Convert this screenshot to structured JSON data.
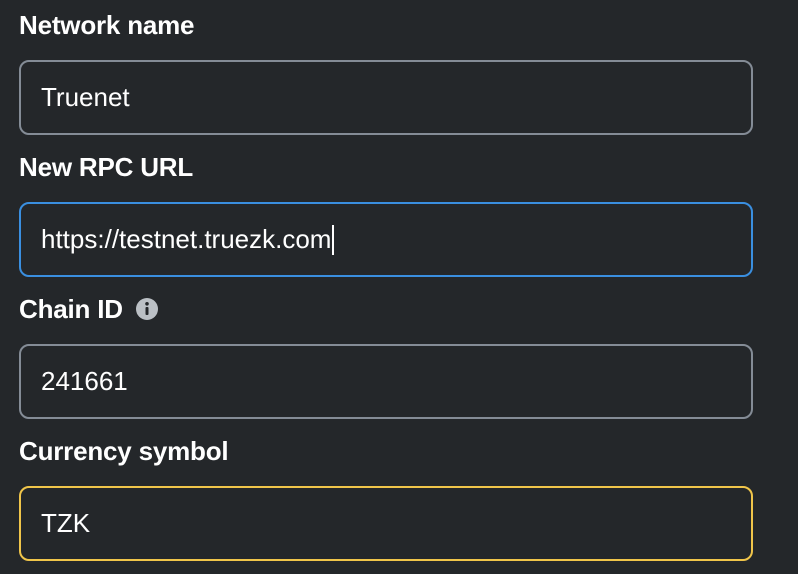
{
  "form": {
    "network_name": {
      "label": "Network name",
      "value": "Truenet"
    },
    "rpc_url": {
      "label": "New RPC URL",
      "value": "https://testnet.truezk.com"
    },
    "chain_id": {
      "label": "Chain ID",
      "info_icon": "info-icon",
      "value": "241661"
    },
    "currency_symbol": {
      "label": "Currency symbol",
      "value": "TZK"
    }
  },
  "colors": {
    "background": "#24272a",
    "default_border": "#848c96",
    "focus_border": "#3a8fe0",
    "warning_border": "#f0c54a",
    "text": "#ffffff"
  }
}
